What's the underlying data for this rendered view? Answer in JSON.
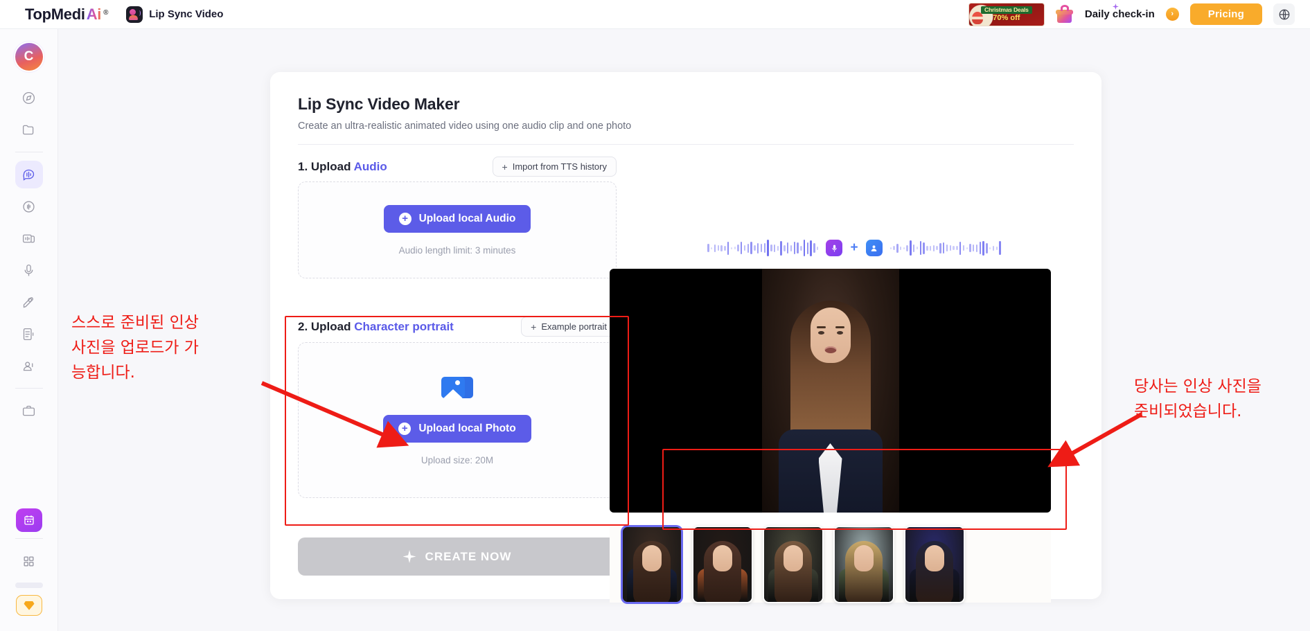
{
  "header": {
    "brand_main": "TopMedi",
    "brand_ai": "Ai",
    "brand_reg": "®",
    "app_name": "Lip Sync Video",
    "promo_line1": "Christmas Deals",
    "promo_line2": "70% off",
    "daily_checkin": "Daily check-in",
    "checkin_arrow": "›",
    "pricing": "Pricing",
    "globe_icon": "globe-icon"
  },
  "sidebar": {
    "avatar_initial": "C",
    "items": [
      {
        "name": "discover",
        "label": "Discover"
      },
      {
        "name": "folder",
        "label": "My Files"
      },
      {
        "name": "lip-sync-video",
        "label": "Lip Sync Video"
      },
      {
        "name": "voice-changer",
        "label": "Voice Changer"
      },
      {
        "name": "video-translate",
        "label": "Video Translate"
      },
      {
        "name": "voice-recorder",
        "label": "Voice Recorder"
      },
      {
        "name": "voice-cloning",
        "label": "Voice Cloning"
      },
      {
        "name": "text-to-speech",
        "label": "Text to Speech"
      },
      {
        "name": "ai-avatar",
        "label": "AI Avatar"
      },
      {
        "name": "workspace",
        "label": "Workspace"
      },
      {
        "name": "calendar-promo",
        "label": "Calendar"
      },
      {
        "name": "apps-grid",
        "label": "All Apps"
      },
      {
        "name": "premium-diamond",
        "label": "Premium"
      }
    ]
  },
  "main": {
    "title": "Lip Sync Video Maker",
    "subtitle": "Create an ultra-realistic animated video using one audio clip and one photo",
    "step1": {
      "number": "1. Upload ",
      "highlight": "Audio",
      "action_label": "Import from TTS history",
      "action_plus": "+",
      "upload_button": "Upload local Audio",
      "upload_plus": "+",
      "hint": "Audio length limit: 3 minutes"
    },
    "step2": {
      "number": "2. Upload ",
      "highlight": "Character portrait",
      "action_label": "Example portrait",
      "action_plus": "+",
      "upload_button": "Upload local Photo",
      "upload_plus": "+",
      "hint": "Upload size: 20M",
      "photo_icon": "image-stack-icon"
    },
    "create_button": "CREATE NOW",
    "create_icon": "sparkle-icon"
  },
  "preview": {
    "mic_icon": "microphone-icon",
    "plus": "+",
    "user_icon": "person-icon",
    "thumbnails": [
      {
        "name": "portrait-1-woman-navy-suit",
        "selected": true,
        "bg": "#3a2b23",
        "hair": "#4b3326",
        "body": "#18203a"
      },
      {
        "name": "portrait-2-man-rust-coat",
        "selected": false,
        "bg": "#241a16",
        "hair": "#52352a",
        "body": "#a3522a"
      },
      {
        "name": "portrait-3-woman-olive-top",
        "selected": false,
        "bg": "#4a4a3c",
        "hair": "#7a5a40",
        "body": "#3c4034"
      },
      {
        "name": "portrait-4-man-green-shirt",
        "selected": false,
        "bg": "#9fb0b2",
        "hair": "#c9a96a",
        "body": "#4c5a40"
      },
      {
        "name": "portrait-5-woman-cyberpunk",
        "selected": false,
        "bg": "#2a2a6e",
        "hair": "#22243a",
        "body": "#14162a"
      }
    ]
  },
  "annotations": {
    "left_text": "스스로 준비된 인상\n사진을 업로드가 가\n능합니다.",
    "right_text": "당사는 인상 사진을\n준비되었습니다.",
    "color": "#EE1C16"
  },
  "colors": {
    "accent_purple": "#5C5CE8",
    "pricing_orange": "#F9AB2B",
    "annotation_red": "#EE1C16",
    "page_bg": "#F7F7FA"
  }
}
